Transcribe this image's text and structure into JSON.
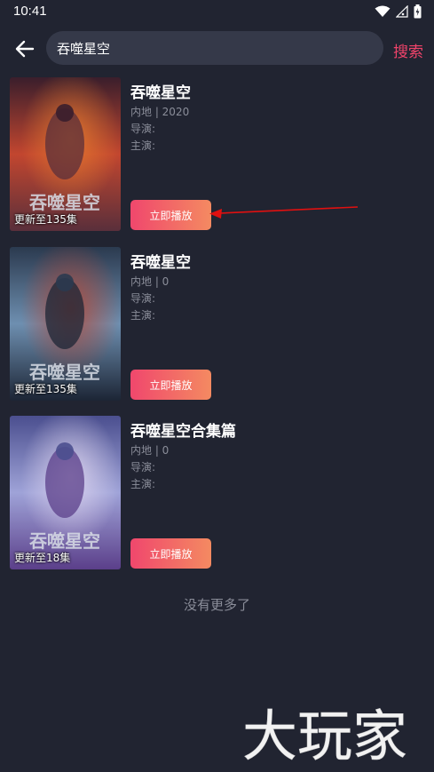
{
  "status_bar": {
    "time": "10:41"
  },
  "search": {
    "query": "吞噬星空",
    "search_label": "搜索"
  },
  "results": [
    {
      "title": "吞噬星空",
      "meta": "内地 | 2020",
      "director": "导演:",
      "cast": "主演:",
      "poster_caption": "更新至135集",
      "poster_title": "吞噬星空",
      "play_label": "立即播放"
    },
    {
      "title": "吞噬星空",
      "meta": "内地 | 0",
      "director": "导演:",
      "cast": "主演:",
      "poster_caption": "更新至135集",
      "poster_title": "吞噬星空",
      "play_label": "立即播放"
    },
    {
      "title": "吞噬星空合集篇",
      "meta": "内地 | 0",
      "director": "导演:",
      "cast": "主演:",
      "poster_caption": "更新至18集",
      "poster_title": "吞噬星空",
      "play_label": "立即播放"
    }
  ],
  "footer": {
    "no_more": "没有更多了"
  },
  "watermark": {
    "text": "大玩家"
  },
  "colors": {
    "background": "#212431",
    "accent": "#f0436a",
    "button_gradient_start": "#f0476d",
    "button_gradient_end": "#f48a61",
    "annotation_arrow": "#e01010"
  }
}
